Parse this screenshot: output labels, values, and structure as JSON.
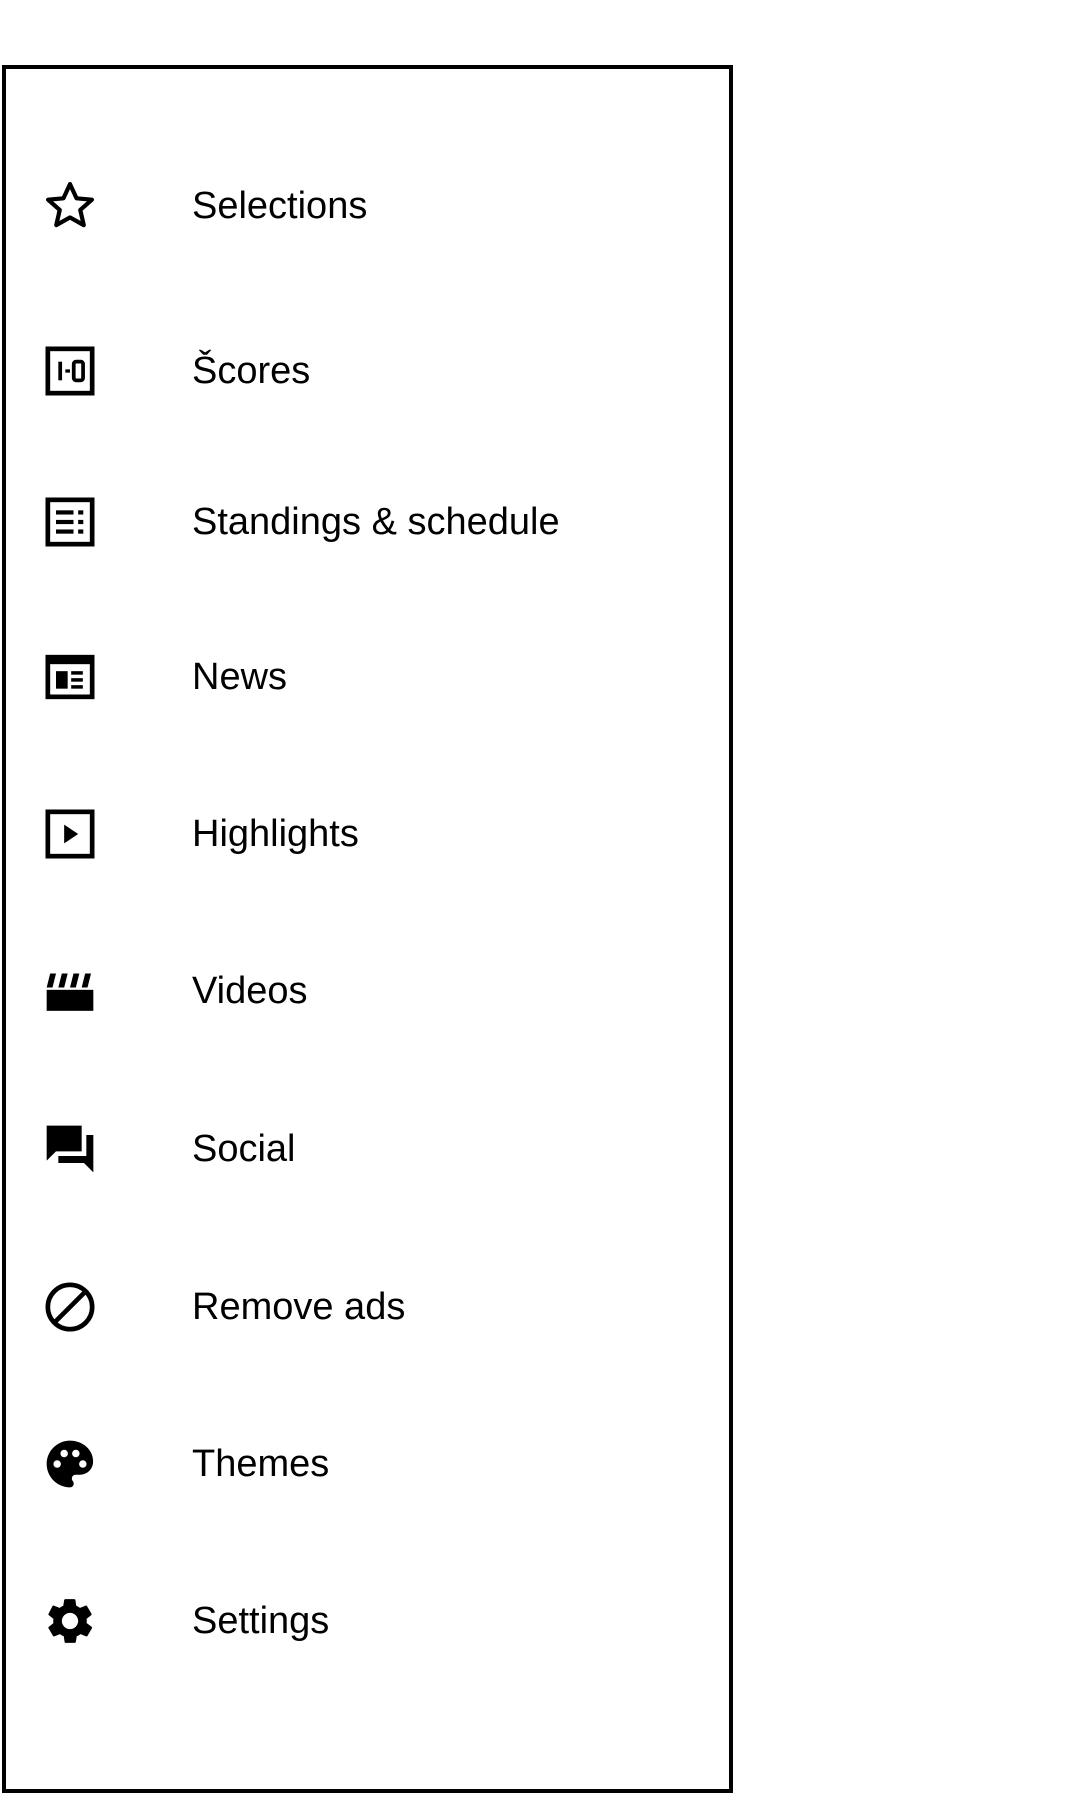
{
  "drawer": {
    "items": [
      {
        "label": "Selections",
        "icon": "star-outline-icon"
      },
      {
        "label": "Šcores",
        "icon": "scoreboard-icon"
      },
      {
        "label": "Standings & schedule",
        "icon": "list-box-icon"
      },
      {
        "label": "News",
        "icon": "newspaper-icon"
      },
      {
        "label": "Highlights",
        "icon": "play-box-icon"
      },
      {
        "label": "Videos",
        "icon": "clapperboard-icon"
      },
      {
        "label": "Social",
        "icon": "chat-bubbles-icon"
      },
      {
        "label": "Remove ads",
        "icon": "block-icon"
      },
      {
        "label": "Themes",
        "icon": "palette-icon"
      },
      {
        "label": "Settings",
        "icon": "gear-icon"
      }
    ]
  }
}
